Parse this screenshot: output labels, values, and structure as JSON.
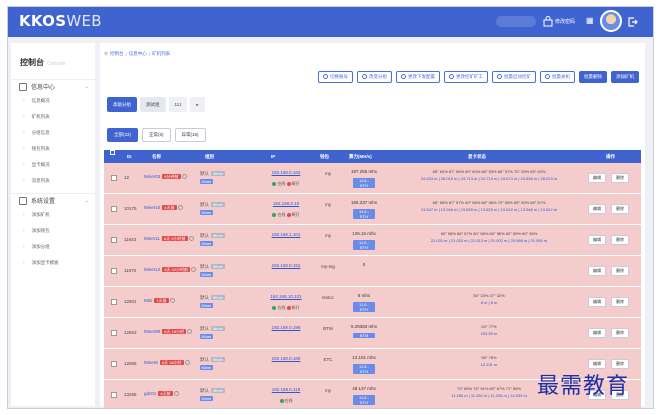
{
  "app": {
    "logo": "KKOS",
    "logo_suffix": "WEB"
  },
  "topbar": {
    "search_placeholder": "",
    "user": "修改密码",
    "grid_glyph": "▦",
    "exit_title": ""
  },
  "sidebar": {
    "title": "控制台",
    "subtitle": "Console",
    "groups": [
      {
        "label": "信息中心",
        "items": [
          "信息概况",
          "矿机列表",
          "分组信息",
          "钱包列表",
          "显卡概况",
          "消息列表"
        ]
      },
      {
        "label": "系统设置",
        "items": [
          "添加矿机",
          "添加钱包",
          "添加分组",
          "添加显卡模板"
        ]
      }
    ]
  },
  "breadcrumb": [
    "控制台",
    "信息中心",
    "矿机列表"
  ],
  "actions": [
    "切换账号",
    "改变分组",
    "更改下发配置",
    "更改挖矿矿工",
    "批量启动挖矿",
    "批量关机",
    "批量删除",
    "添加矿机"
  ],
  "filters": {
    "primary": "高级分组",
    "select_label": "测试组",
    "count": "111",
    "toggle": "▸"
  },
  "tabs": [
    "全部(33)",
    "正常(6)",
    "异常(16)"
  ],
  "table": {
    "headers": [
      "ID",
      "名称",
      "组别",
      "IP",
      "钱包",
      "算力(MH/s)",
      "显卡状态",
      "操作"
    ],
    "rows": [
      {
        "id": "12",
        "name": "Miner03",
        "tag": "6分钟前",
        "group": "默认",
        "gbadge": "Miner",
        "ip": "192.168.0.163",
        "on": "在线",
        "off": "断开",
        "coin": "my",
        "speed": "197.266 mhs",
        "kpill": "11.6 - ETH",
        "gpu": "68° 60% 67° 56% 69° 60% 68° 53% 66° 57% 70° 59% 69° 60%",
        "gsub": "24.633 m | 28.016 m | 24.714 m | 24.713 m | 24.674 m | 24.838 m | 28.023 m"
      },
      {
        "id": "10175",
        "name": "Miner10",
        "tag": "4天前",
        "group": "默认",
        "gbadge": "Miner",
        "ip": "192.168.0.19",
        "on": "在线",
        "off": "断开",
        "coin": "my",
        "speed": "165.237 mhs",
        "kpill": "11.6 - ETH",
        "gpu": "68° 58% 67° 57% 69° 58% 68° 56% 70° 55% 66° 59% 68° 57%",
        "gsub": "13.547 m | 13.546 m | 13.555 m | 13.633 m | 13.542 m | 13.548 m | 13.542 m"
      },
      {
        "id": "11643",
        "name": "Miner11",
        "tag": "6天 9小时前",
        "group": "默认",
        "gbadge": "Miner",
        "ip": "192.168.1.101",
        "on": "",
        "off": "",
        "coin": "my",
        "speed": "126.15 mhs",
        "kpill": "11.6 - ETH",
        "gpu": "60° 58% 66° 57% 60° 58% 60° 56% 62° 55% 60° 56%",
        "gsub": "21.031 m | 21.033 m | 21.013 m | 21.002 m | 20.988 m | 21.055 m"
      },
      {
        "id": "11970",
        "name": "Miner12",
        "tag": "3天 22小时前",
        "group": "默认",
        "gbadge": "Miner",
        "ip": "192.168.0.152",
        "on": "",
        "off": "",
        "coin": "my-mg",
        "speed": "0",
        "kpill": "",
        "gpu": "",
        "gsub": ""
      },
      {
        "id": "12501",
        "name": "Mini",
        "tag": "7天前",
        "group": "默认",
        "gbadge": "Miner",
        "ip": "192.168.10.101",
        "on": "在线",
        "off": "断开",
        "coin": "testcc",
        "speed": "8 mhs",
        "kpill": "11.6 - ETH",
        "gpu": "36° 33% 37° 32%",
        "gsub": "8 m | 8 m"
      },
      {
        "id": "12653",
        "name": "Miner80",
        "tag": "6天 18小时",
        "group": "默认",
        "gbadge": "Miner",
        "ip": "192.168.0.196",
        "on": "",
        "off": "",
        "coin": "BTM",
        "speed": "9.29383 mhs",
        "kpill": "BTM",
        "gpu": "63° 77%",
        "gsub": "293.83 m"
      },
      {
        "id": "12666",
        "name": "Miner8",
        "tag": "6天 18小时",
        "group": "默认",
        "gbadge": "Miner",
        "ip": "192.168.0.169",
        "on": "",
        "off": "",
        "coin": "ETC",
        "speed": "13.101 mhs",
        "kpill": "11.6 - ETH",
        "gpu": "58° 78%",
        "gsub": "13.101 m"
      },
      {
        "id": "13265",
        "name": "gdc01",
        "tag": "4天前",
        "group": "默认",
        "gbadge": "Miner",
        "ip": "192.168.0.118",
        "on": "在线",
        "off": "",
        "coin": "my",
        "speed": "48.137 mhs",
        "kpill": "11.6 - ETH",
        "gpu": "79° 65% 76° 51% 69° 67% 71° 56%",
        "gsub": "11.186 m | 11.262 m | 11.206 m | 14.533 m"
      }
    ],
    "row_actions": [
      "编辑",
      "删除"
    ]
  },
  "watermark": "最需教育",
  "colors": {
    "primary": "#3f63cf",
    "row_alert": "#f4cccc",
    "tag_red": "#e24a4a",
    "watermark": "#1f2fa8"
  }
}
